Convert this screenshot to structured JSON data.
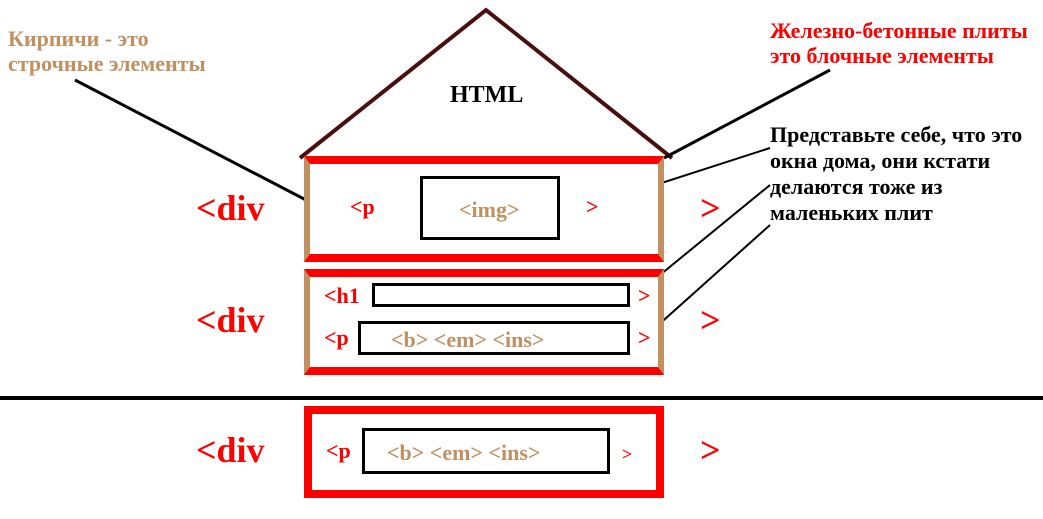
{
  "captions": {
    "left": "Кирпичи - это\nстрочные элементы",
    "rightTop": "Железно-бетонные плиты\nэто блочные элементы",
    "rightBlack": "Представьте себе, что это окна дома, они кстати делаются тоже из маленьких плит"
  },
  "roof": {
    "label": "HTML"
  },
  "floors": {
    "f1": {
      "divOpen": "<div",
      "divClose": ">",
      "pOpen": "<p",
      "pClose": ">",
      "imgBox": "<img>"
    },
    "f2": {
      "divOpen": "<div",
      "divClose": ">",
      "h1Open": "<h1",
      "h1Close": ">",
      "pOpen": "<p",
      "pClose": ">",
      "inlineSeq": "<b> <em> <ins>"
    },
    "f3": {
      "divOpen": "<div",
      "divClose": ">",
      "pOpen": "<p",
      "pClose": ">",
      "inlineSeq": "<b> <em> <ins>"
    }
  }
}
